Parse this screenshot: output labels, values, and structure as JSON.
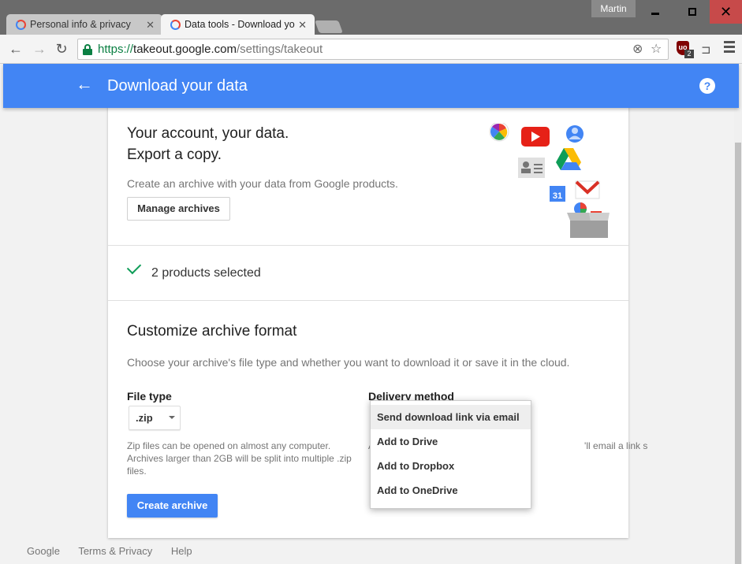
{
  "browser": {
    "tabs": [
      {
        "title": "Personal info & privacy",
        "active": false
      },
      {
        "title": "Data tools - Download yo",
        "active": true
      }
    ],
    "profile_name": "Martin",
    "url": {
      "scheme": "https://",
      "host": "takeout.google.com",
      "path": "/settings/takeout"
    }
  },
  "appbar": {
    "title": "Download your data",
    "help": "?"
  },
  "hero": {
    "title_line1": "Your account, your data.",
    "title_line2": "Export a copy.",
    "description": "Create an archive with your data from Google products.",
    "manage_button": "Manage archives"
  },
  "products": {
    "selected_text": "2 products selected"
  },
  "customize": {
    "title": "Customize archive format",
    "description": "Choose your archive's file type and whether you want to download it or save it in the cloud.",
    "file_type_label": "File type",
    "file_type_value": ".zip",
    "file_type_help": "Zip files can be opened on almost any computer. Archives larger than 2GB will be split into multiple .zip files.",
    "delivery_label": "Delivery method",
    "delivery_help": "A                                                                                'll email a link s                                                          al device. You v                                                                 ive.",
    "create_button": "Create archive"
  },
  "delivery_menu": {
    "items": [
      {
        "label": "Send download link via email",
        "selected": true
      },
      {
        "label": "Add to Drive",
        "selected": false
      },
      {
        "label": "Add to Dropbox",
        "selected": false
      },
      {
        "label": "Add to OneDrive",
        "selected": false
      }
    ]
  },
  "footer": {
    "links": [
      "Google",
      "Terms & Privacy",
      "Help"
    ]
  },
  "colors": {
    "primary": "#4285f4",
    "check": "#0f9d58",
    "lock": "#0b8043"
  }
}
